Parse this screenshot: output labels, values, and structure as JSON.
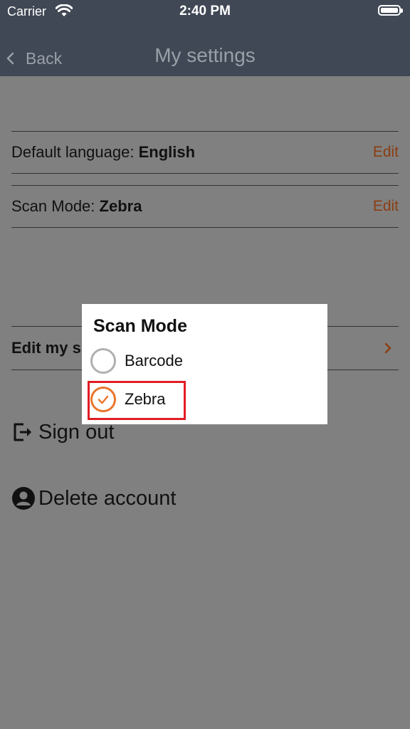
{
  "status_bar": {
    "carrier": "Carrier",
    "time": "2:40 PM",
    "wifi_icon": "wifi-icon",
    "battery_icon": "battery-icon"
  },
  "nav": {
    "back_label": "Back",
    "title": "My settings"
  },
  "settings": {
    "language": {
      "label": "Default language:",
      "value": "English",
      "edit": "Edit"
    },
    "scan_mode": {
      "label": "Scan Mode:",
      "value": "Zebra",
      "edit": "Edit"
    },
    "edit_subscription_label": "Edit my s"
  },
  "actions": {
    "sign_out": {
      "label": "Sign out",
      "icon": "sign-out-icon"
    },
    "delete_account": {
      "label": "Delete account",
      "icon": "account-icon"
    }
  },
  "dialog": {
    "title": "Scan Mode",
    "options": [
      {
        "label": "Barcode",
        "selected": false
      },
      {
        "label": "Zebra",
        "selected": true
      }
    ]
  },
  "colors": {
    "nav_bar": "#404855",
    "overlay": "#808080",
    "accent": "#e8762d",
    "edit_link": "#8a3e12",
    "highlight": "#e11d24"
  }
}
